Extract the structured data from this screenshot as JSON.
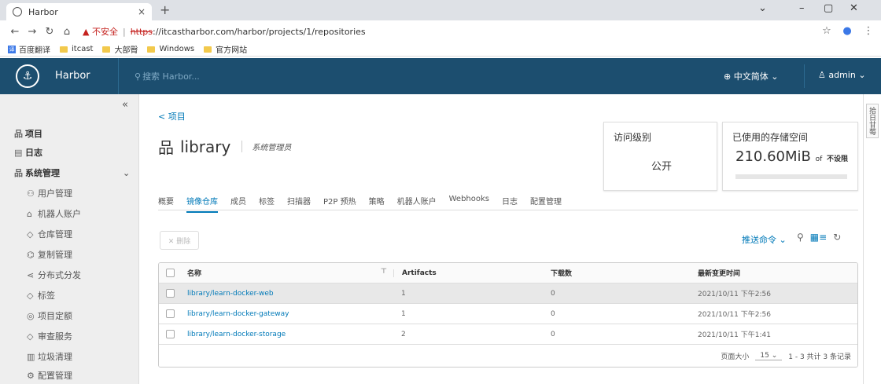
{
  "browser": {
    "tab_title": "Harbor",
    "tab_close": "×",
    "new_tab": "+",
    "url_warning": "▲ 不安全",
    "url_scheme": "https",
    "url_rest": "://itcastharbor.com/harbor/projects/1/repositories",
    "bookmarks": [
      "百度翻译",
      "itcast",
      "大部臀",
      "Windows",
      "官方网站"
    ]
  },
  "header": {
    "brand": "Harbor",
    "search_placeholder": "搜索 Harbor...",
    "language": "中文简体 ⌄",
    "user": "admin ⌄"
  },
  "sidebar": {
    "items": [
      {
        "icon": "品",
        "label": "项目"
      },
      {
        "icon": "▤",
        "label": "日志"
      },
      {
        "icon": "品",
        "label": "系统管理"
      }
    ],
    "subitems": [
      {
        "icon": "⚇",
        "label": "用户管理"
      },
      {
        "icon": "⌂",
        "label": "机器人账户"
      },
      {
        "icon": "◇",
        "label": "仓库管理"
      },
      {
        "icon": "⌬",
        "label": "复制管理"
      },
      {
        "icon": "⋖",
        "label": "分布式分发"
      },
      {
        "icon": "◇",
        "label": "标签"
      },
      {
        "icon": "◎",
        "label": "项目定额"
      },
      {
        "icon": "◇",
        "label": "审查服务"
      },
      {
        "icon": "▥",
        "label": "垃圾清理"
      },
      {
        "icon": "⚙",
        "label": "配置管理"
      }
    ]
  },
  "main": {
    "back": "< 项目",
    "project_name": "library",
    "role": "系统管理员",
    "access_label": "访问级别",
    "access_value": "公开",
    "storage_label": "已使用的存储空间",
    "storage_value": "210.60",
    "storage_unit": "MiB",
    "storage_of": "of",
    "storage_limit": "不设限",
    "tabs": [
      "概要",
      "镜像仓库",
      "成员",
      "标签",
      "扫描器",
      "P2P 预热",
      "策略",
      "机器人账户",
      "Webhooks",
      "日志",
      "配置管理"
    ],
    "delete_btn": "✕ 删除",
    "push_cmd": "推送命令 ⌄"
  },
  "table": {
    "headers": [
      "名称",
      "Artifacts",
      "下载数",
      "最新变更时间"
    ],
    "rows": [
      {
        "name": "library/learn-docker-web",
        "artifacts": "1",
        "downloads": "0",
        "time": "2021/10/11 下午2:56"
      },
      {
        "name": "library/learn-docker-gateway",
        "artifacts": "1",
        "downloads": "0",
        "time": "2021/10/11 下午2:56"
      },
      {
        "name": "library/learn-docker-storage",
        "artifacts": "2",
        "downloads": "0",
        "time": "2021/10/11 下午1:41"
      }
    ],
    "page_size_label": "页面大小",
    "page_size": "15 ⌄",
    "summary": "1 - 3 共计 3 条记录"
  },
  "right_panel": "拾日甘莓"
}
